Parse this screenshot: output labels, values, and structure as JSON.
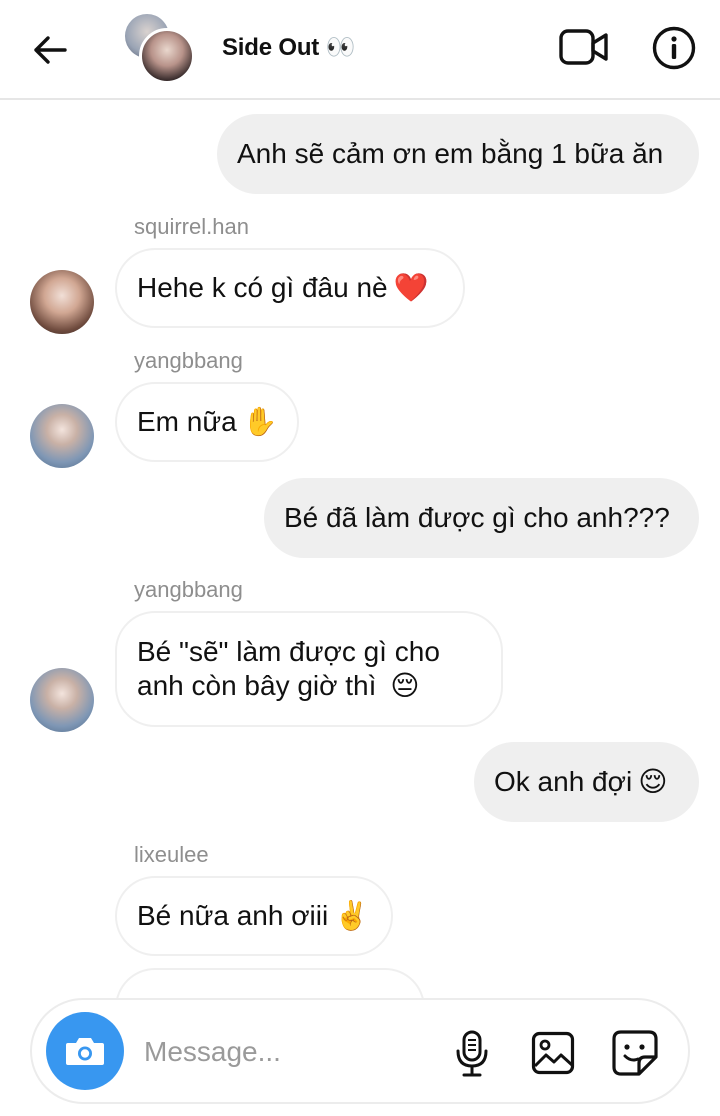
{
  "header": {
    "title": "Side Out",
    "title_emoji": "👀",
    "icons": {
      "back": "back-arrow-icon",
      "video": "video-call-icon",
      "info": "info-icon"
    }
  },
  "messages": [
    {
      "type": "outgoing",
      "text": "Anh sẽ cảm ơn em bằng 1 bữa ăn"
    },
    {
      "type": "incoming",
      "sender": "squirrel.han",
      "text": "Hehe k có gì đâu nè",
      "emoji": "❤️"
    },
    {
      "type": "incoming",
      "sender": "yangbbang",
      "text": "Em nữa",
      "emoji": "✋"
    },
    {
      "type": "outgoing",
      "text": "Bé đã làm được gì cho anh???"
    },
    {
      "type": "incoming",
      "sender": "yangbbang",
      "line1": "Bé \"sẽ\" làm được gì cho",
      "line2": "anh còn bây giờ thì",
      "emoji": "😔"
    },
    {
      "type": "outgoing",
      "text": "Ok anh đợi",
      "emoji": "😌"
    },
    {
      "type": "incoming",
      "sender": "lixeulee",
      "text": "Bé nữa anh ơiii",
      "emoji": "✌️"
    }
  ],
  "composer": {
    "placeholder": "Message...",
    "icons": {
      "camera": "camera-icon",
      "mic": "microphone-icon",
      "gallery": "gallery-icon",
      "sticker": "sticker-icon"
    }
  },
  "colors": {
    "outgoing_bubble": "#efefef",
    "camera_button": "#3897f0",
    "sender_text": "#8e8e8e"
  }
}
